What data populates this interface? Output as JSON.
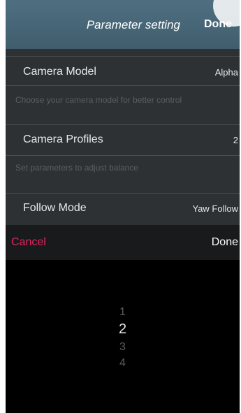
{
  "nav": {
    "title": "Parameter setting",
    "done_label": "Done"
  },
  "settings": [
    {
      "label": "Camera Model",
      "value": "Alpha",
      "description": "Choose your camera model for better control"
    },
    {
      "label": "Camera Profiles",
      "value": "2",
      "description": "Set parameters to adjust balance"
    },
    {
      "label": "Follow Mode",
      "value": "Yaw Follow"
    }
  ],
  "toolbar": {
    "cancel_label": "Cancel",
    "done_label": "Done"
  },
  "picker": {
    "options": [
      "1",
      "2",
      "3",
      "4"
    ],
    "selected": "2"
  },
  "colors": {
    "nav_bg": "#46677a",
    "cancel_accent": "#e0245e",
    "content_bg": "#2d3134",
    "picker_bg": "#000000"
  }
}
